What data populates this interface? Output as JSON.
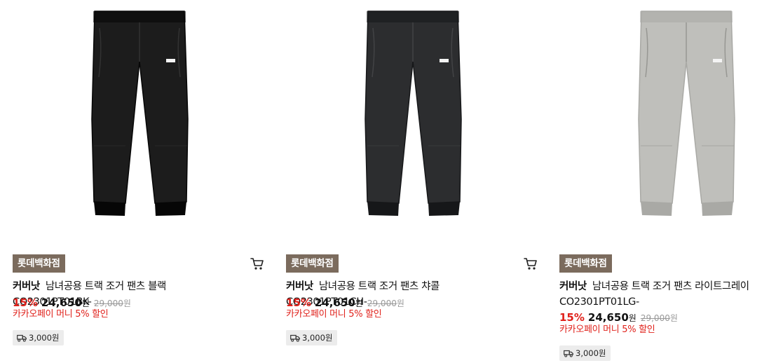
{
  "products": [
    {
      "store": "롯데백화점",
      "brand": "커버낫",
      "title": "남녀공용 트랙 조거 팬츠 블랙 CO2301PT01BK-",
      "discount": "15%",
      "sale_price": "24,650",
      "currency": "원",
      "original_price": "29,000",
      "promo": "카카오페이 머니 5% 할인",
      "shipping": "3,000원",
      "color": "#1c1c1c",
      "image_icon": "pants-image",
      "cart_icon": "cart-icon",
      "shipping_icon": "truck-icon"
    },
    {
      "store": "롯데백화점",
      "brand": "커버낫",
      "title": "남녀공용 트랙 조거 팬츠 챠콜 CO2301PT01CH-",
      "discount": "15%",
      "sale_price": "24,650",
      "currency": "원",
      "original_price": "29,000",
      "promo": "카카오페이 머니 5% 할인",
      "shipping": "3,000원",
      "color": "#2c2d2f",
      "image_icon": "pants-image",
      "cart_icon": "cart-icon",
      "shipping_icon": "truck-icon"
    },
    {
      "store": "롯데백화점",
      "brand": "커버낫",
      "title": "남녀공용 트랙 조거 팬츠 라이트그레이 CO2301PT01LG-",
      "discount": "15%",
      "sale_price": "24,650",
      "currency": "원",
      "original_price": "29,000",
      "promo": "카카오페이 머니 5% 할인",
      "shipping": "3,000원",
      "color": "#bfbfbb",
      "image_icon": "pants-image",
      "cart_icon": "cart-icon",
      "shipping_icon": "truck-icon"
    }
  ],
  "colors": {
    "store_badge": "#7b6b5d",
    "discount_red": "#e0211b",
    "shipping_chip": "#ececec"
  }
}
